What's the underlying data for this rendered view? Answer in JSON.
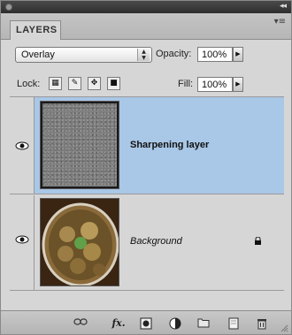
{
  "panel": {
    "tab_label": "LAYERS",
    "menu_glyph": "▾≡"
  },
  "blend_mode": {
    "selected": "Overlay"
  },
  "opacity": {
    "label": "Opacity:",
    "value": "100%"
  },
  "lock": {
    "label": "Lock:"
  },
  "fill": {
    "label": "Fill:",
    "value": "100%"
  },
  "layers": [
    {
      "name": "Sharpening layer",
      "visible": true,
      "selected": true,
      "locked": false
    },
    {
      "name": "Background",
      "visible": true,
      "selected": false,
      "locked": true
    }
  ],
  "bottom_toolbar": {
    "icons": [
      "link-layers-icon",
      "layer-style-fx-icon",
      "add-mask-icon",
      "adjustment-layer-icon",
      "new-group-icon",
      "new-layer-icon",
      "delete-layer-icon"
    ],
    "fx_text": "fx."
  },
  "colors": {
    "selected_row": "#a9c7e6",
    "panel_bg": "#d6d6d6"
  }
}
